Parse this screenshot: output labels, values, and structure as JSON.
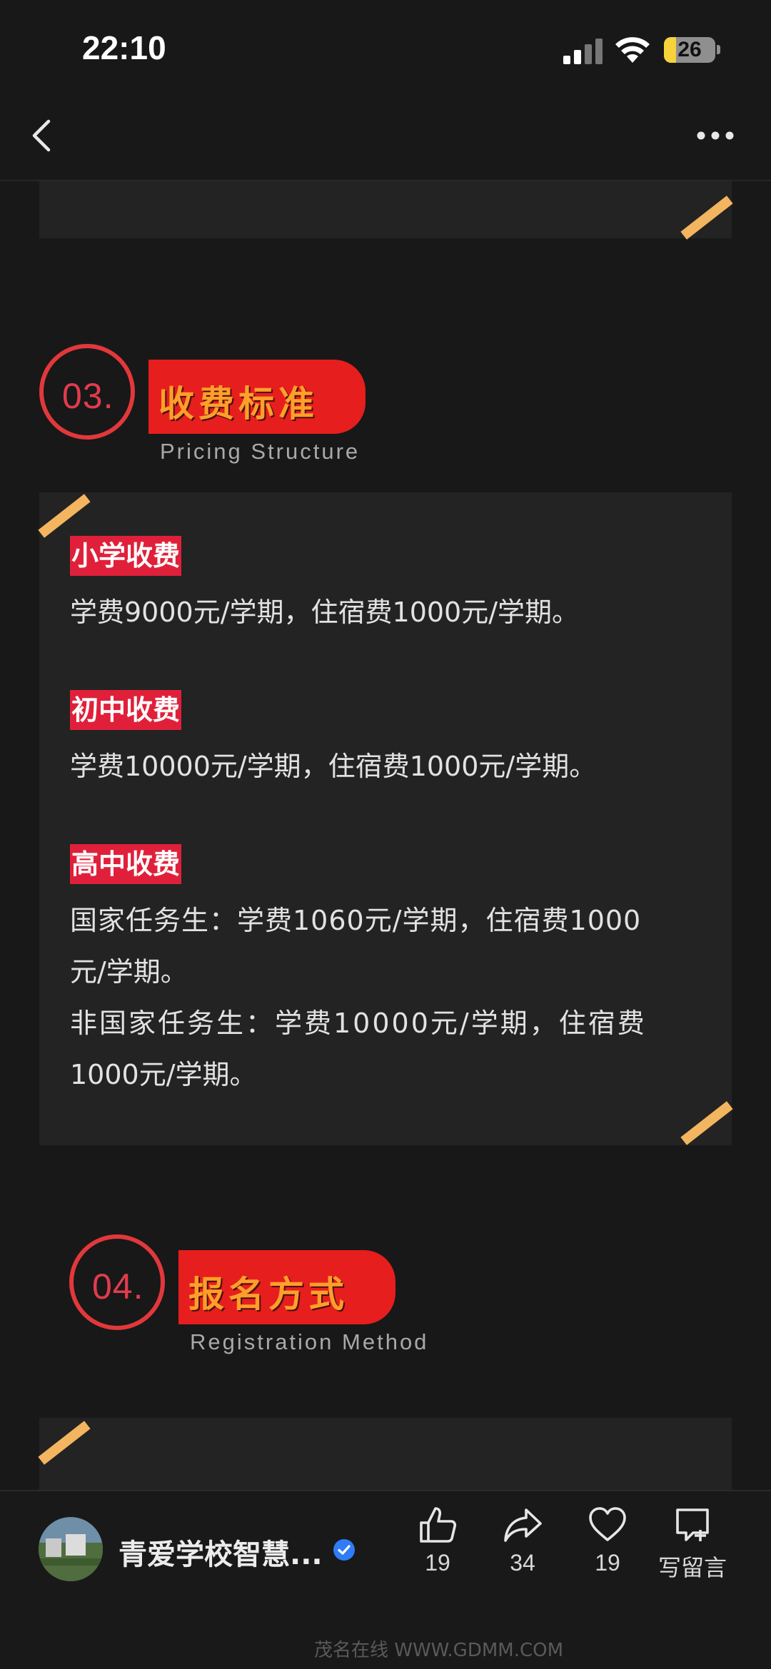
{
  "status_bar": {
    "time": "22:10",
    "battery": "26"
  },
  "sections": {
    "pricing": {
      "number": "03.",
      "title": "收费标准",
      "subtitle": "Pricing Structure"
    },
    "registration": {
      "number": "04.",
      "title": "报名方式",
      "subtitle": "Registration Method"
    }
  },
  "pricing_items": [
    {
      "tag": "小学收费",
      "lines": [
        "学费9000元/学期，住宿费1000元/学期。"
      ]
    },
    {
      "tag": "初中收费",
      "lines": [
        "学费10000元/学期，住宿费1000元/学期。"
      ]
    },
    {
      "tag": "高中收费",
      "lines": [
        "国家任务生：学费1060元/学期，住宿费1000",
        "元/学期。",
        "非国家任务生：学费10000元/学期，住宿费",
        "1000元/学期。"
      ]
    }
  ],
  "bottom_bar": {
    "account_name": "青爱学校智慧...",
    "like_count": "19",
    "share_count": "34",
    "favorite_count": "19",
    "comment_label": "写留言"
  },
  "watermark": "茂名在线 WWW.GDMM.COM",
  "colors": {
    "accent_red": "#e61e1e",
    "title_orange": "#ff9f2a",
    "stripe_gold": "#f3b55f",
    "tag_red": "#e0203a"
  }
}
